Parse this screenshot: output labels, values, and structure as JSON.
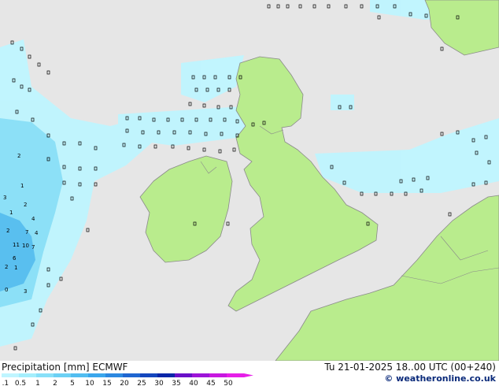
{
  "footer": {
    "title": "Precipitation [mm]  ECMWF",
    "run": "Tu 21-01-2025 18..00 UTC (00+240)",
    "site": "© weatheronline.co.uk"
  },
  "legend": {
    "ticks": [
      "0.1",
      "0.5",
      "1",
      "2",
      "5",
      "10",
      "15",
      "20",
      "25",
      "30",
      "35",
      "40",
      "45",
      "50"
    ],
    "colors": [
      "#bff5ff",
      "#a4eefc",
      "#88e0f8",
      "#6cd0f4",
      "#52bdf0",
      "#3aa6ec",
      "#2c88e0",
      "#1f66d0",
      "#1446bd",
      "#0a26a8",
      "#6a10c8",
      "#9d14d8",
      "#c818e0",
      "#e61fe8"
    ]
  },
  "colors": {
    "sea": "#e6e6e6",
    "land": "#b9ec8d",
    "border": "#8a8a8a",
    "precip_light": "#bff5ff",
    "precip_medium": "#88e0f8",
    "precip_heavy": "#52bdf0"
  },
  "regions": [
    "ireland",
    "great-britain",
    "continental-europe",
    "scandinavia"
  ],
  "values": {
    "west_cluster": [
      "2",
      "7",
      "4",
      "11",
      "10",
      "7",
      "6",
      "2",
      "1",
      "3",
      "1",
      "2",
      "4",
      "1",
      "0",
      "2",
      "3"
    ]
  }
}
